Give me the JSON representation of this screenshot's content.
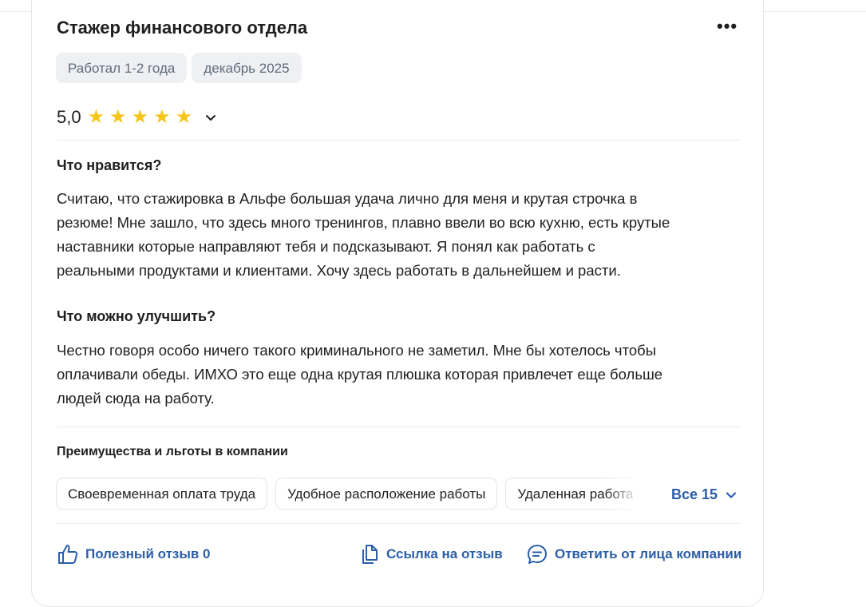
{
  "review": {
    "title": "Стажер финансового отдела",
    "more_label": "•••",
    "tags": [
      "Работал 1-2 года",
      "декабрь 2025"
    ],
    "rating": {
      "value_text": "5,0",
      "stars": 5,
      "max_stars": 5
    },
    "likes_heading": "Что нравится?",
    "likes_lines": [
      "Считаю, что стажировка в Альфе большая удача лично для меня и крутая строчка в",
      "резюме! Мне зашло, что здесь много тренингов, плавно ввели во всю кухню, есть крутые",
      "наставники которые направляют тебя и подсказывают. Я понял как работать с",
      "реальными продуктами и клиентами. Хочу здесь работать в дальнейшем и расти."
    ],
    "improve_heading": "Что можно улучшить?",
    "improve_lines": [
      "Честно говоря особо ничего такого криминального не заметил. Мне бы хотелось чтобы",
      "оплачивали обеды. ИМХО это еще одна крутая плюшка которая привлечет еще больше",
      "людей сюда на работу."
    ]
  },
  "perks": {
    "heading": "Преимущества и льготы в компании",
    "chips": [
      "Своевременная оплата труда",
      "Удобное расположение работы",
      "Удаленная работа"
    ],
    "all_label": "Все 15"
  },
  "actions": {
    "helpful": "Полезный отзыв 0",
    "link": "Ссылка на отзыв",
    "reply": "Ответить от лица компании"
  },
  "colors": {
    "accent": "#2b5ea8",
    "star": "#f5c518",
    "tag_bg": "#eef0f4"
  },
  "icons": [
    "more-icon",
    "star-icon",
    "chevron-down-icon",
    "thumbs-up-icon",
    "copy-link-icon",
    "comment-icon"
  ]
}
